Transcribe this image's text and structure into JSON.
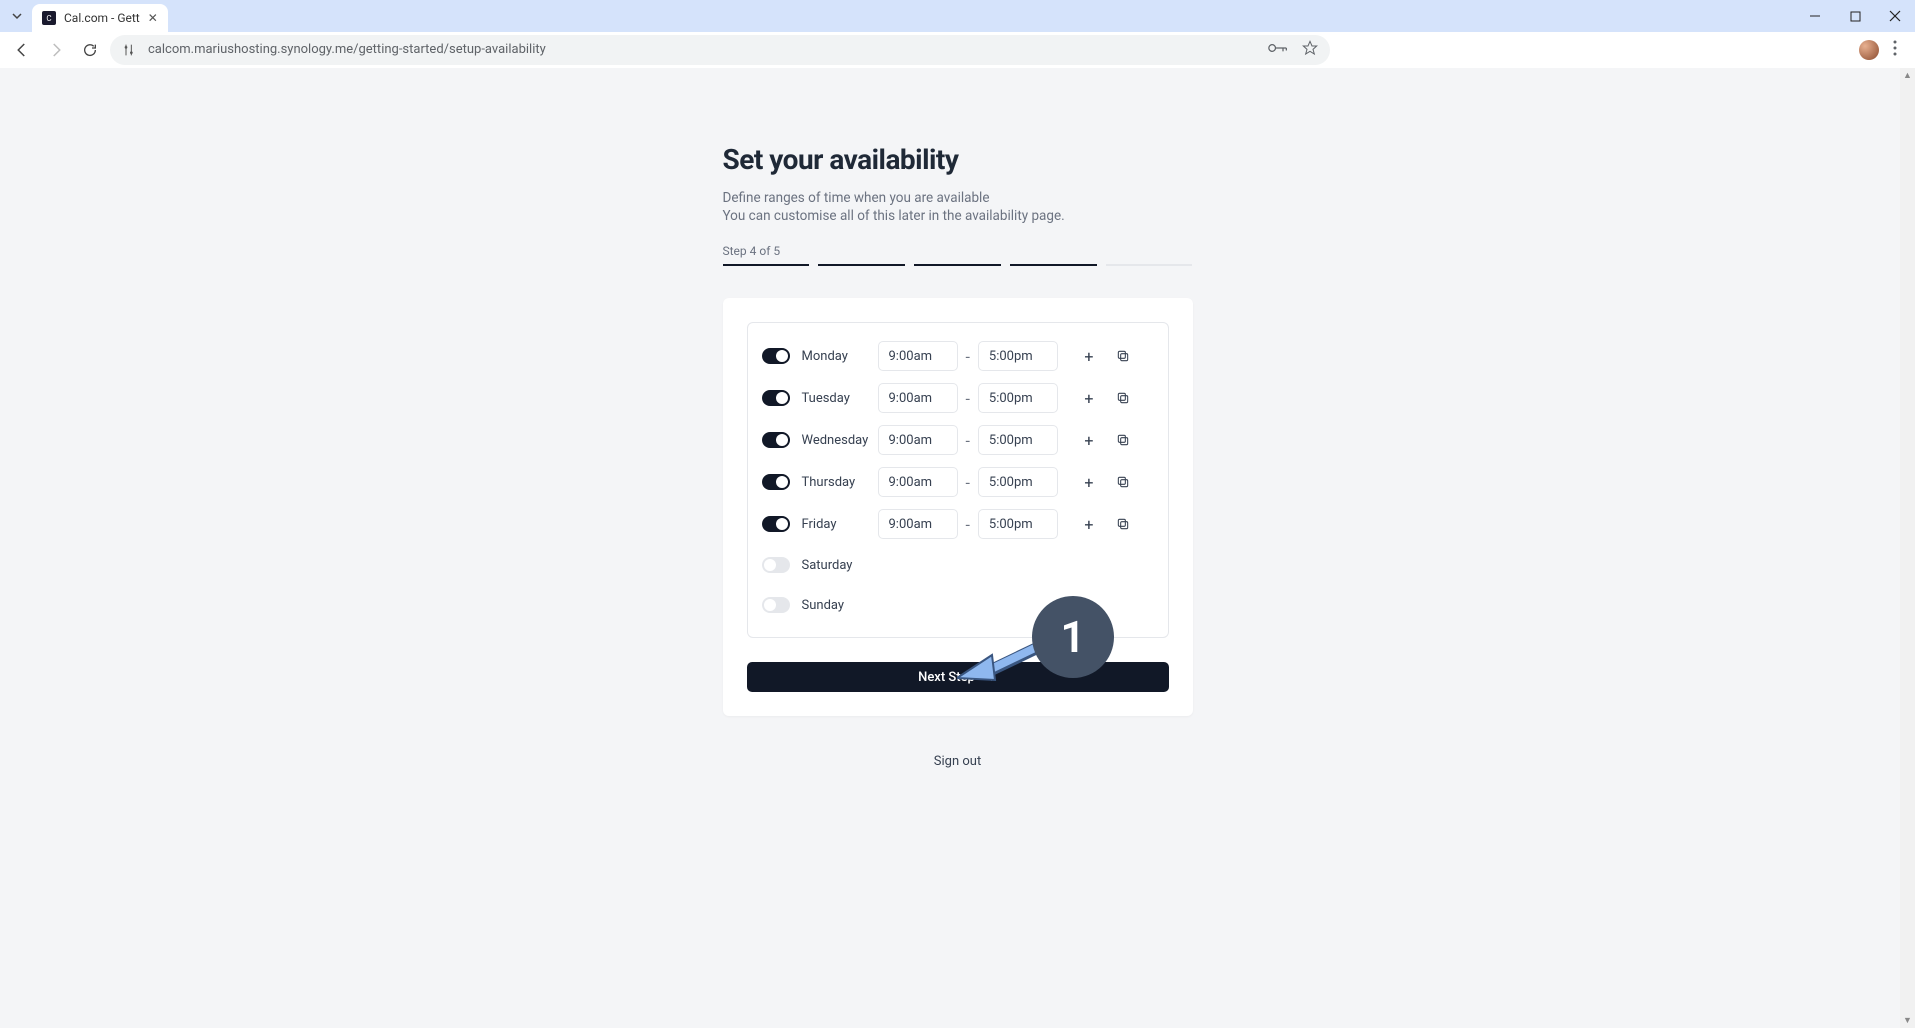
{
  "browser": {
    "tab_title": "Cal.com - Gett",
    "url": "calcom.mariushosting.synology.me/getting-started/setup-availability"
  },
  "header": {
    "title": "Set your availability",
    "subtitle_line1": "Define ranges of time when you are available",
    "subtitle_line2": "You can customise all of this later in the availability page.",
    "step_label": "Step 4 of 5",
    "progress_completed": 4,
    "progress_total": 5
  },
  "days": [
    {
      "name": "Monday",
      "enabled": true,
      "start": "9:00am",
      "end": "5:00pm"
    },
    {
      "name": "Tuesday",
      "enabled": true,
      "start": "9:00am",
      "end": "5:00pm"
    },
    {
      "name": "Wednesday",
      "enabled": true,
      "start": "9:00am",
      "end": "5:00pm"
    },
    {
      "name": "Thursday",
      "enabled": true,
      "start": "9:00am",
      "end": "5:00pm"
    },
    {
      "name": "Friday",
      "enabled": true,
      "start": "9:00am",
      "end": "5:00pm"
    },
    {
      "name": "Saturday",
      "enabled": false,
      "start": "",
      "end": ""
    },
    {
      "name": "Sunday",
      "enabled": false,
      "start": "",
      "end": ""
    }
  ],
  "buttons": {
    "next": "Next Step",
    "sign_out": "Sign out"
  },
  "annotation": {
    "number": "1"
  }
}
